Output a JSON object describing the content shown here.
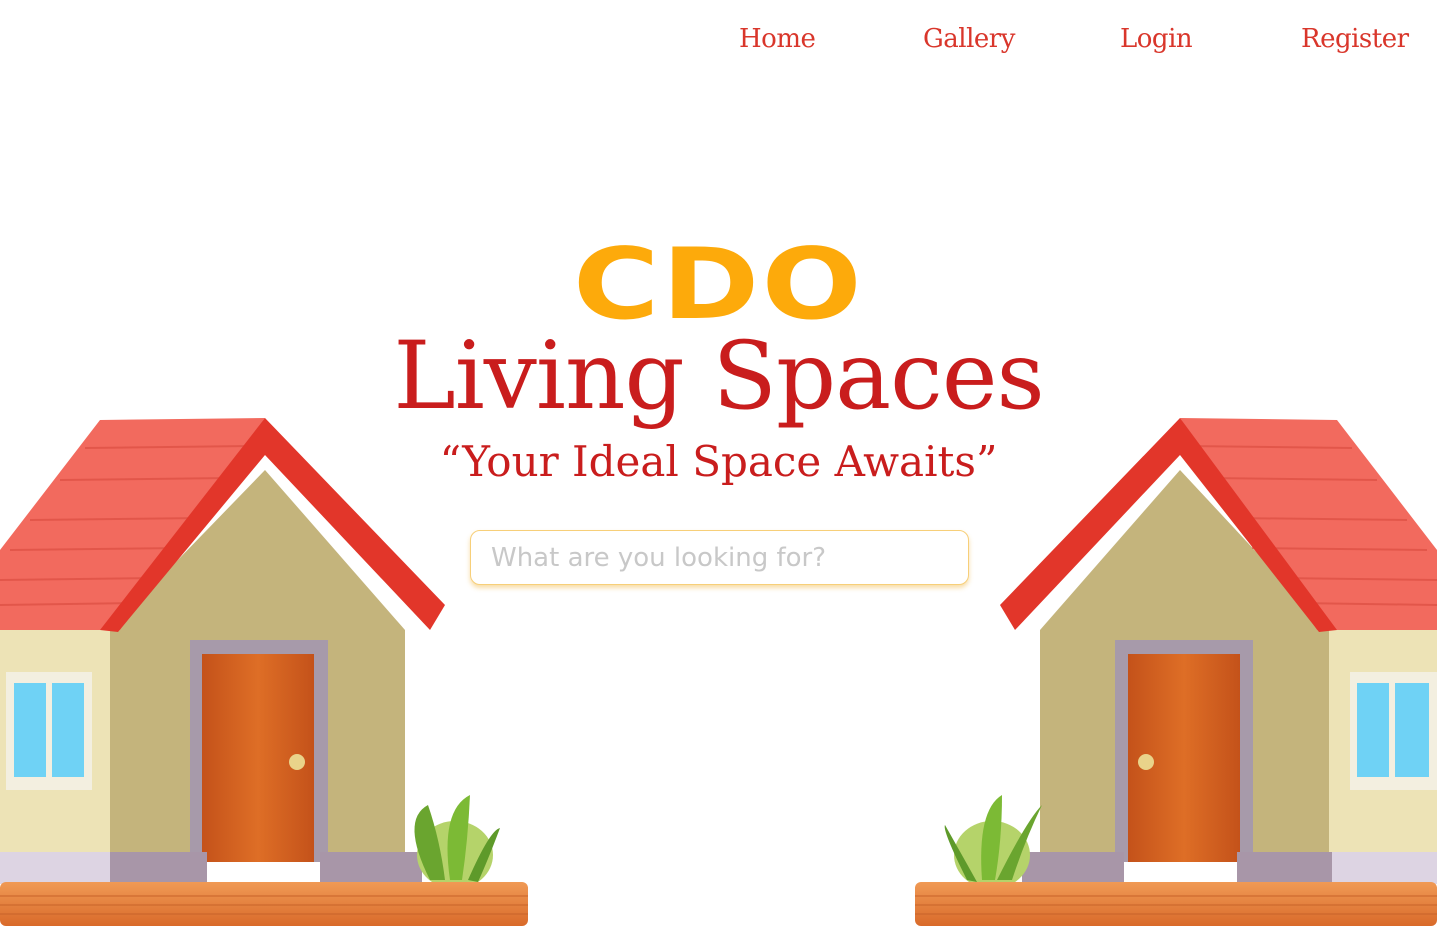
{
  "nav": {
    "home": "Home",
    "gallery": "Gallery",
    "login": "Login",
    "register": "Register"
  },
  "hero": {
    "brand": "CDO",
    "title": "Living Spaces",
    "tagline": "“Your Ideal Space Awaits”"
  },
  "search": {
    "placeholder": "What are you looking for?"
  },
  "colors": {
    "nav": "#d9362b",
    "brand": "#fdaa0b",
    "title": "#c91d1d",
    "roof": "#ef5248",
    "wall": "#c8b878",
    "door": "#d2621c",
    "window": "#6fd2f5",
    "base": "#e37e3c"
  },
  "icons": [
    "house-illustration-left",
    "house-illustration-right",
    "plant-icon"
  ]
}
